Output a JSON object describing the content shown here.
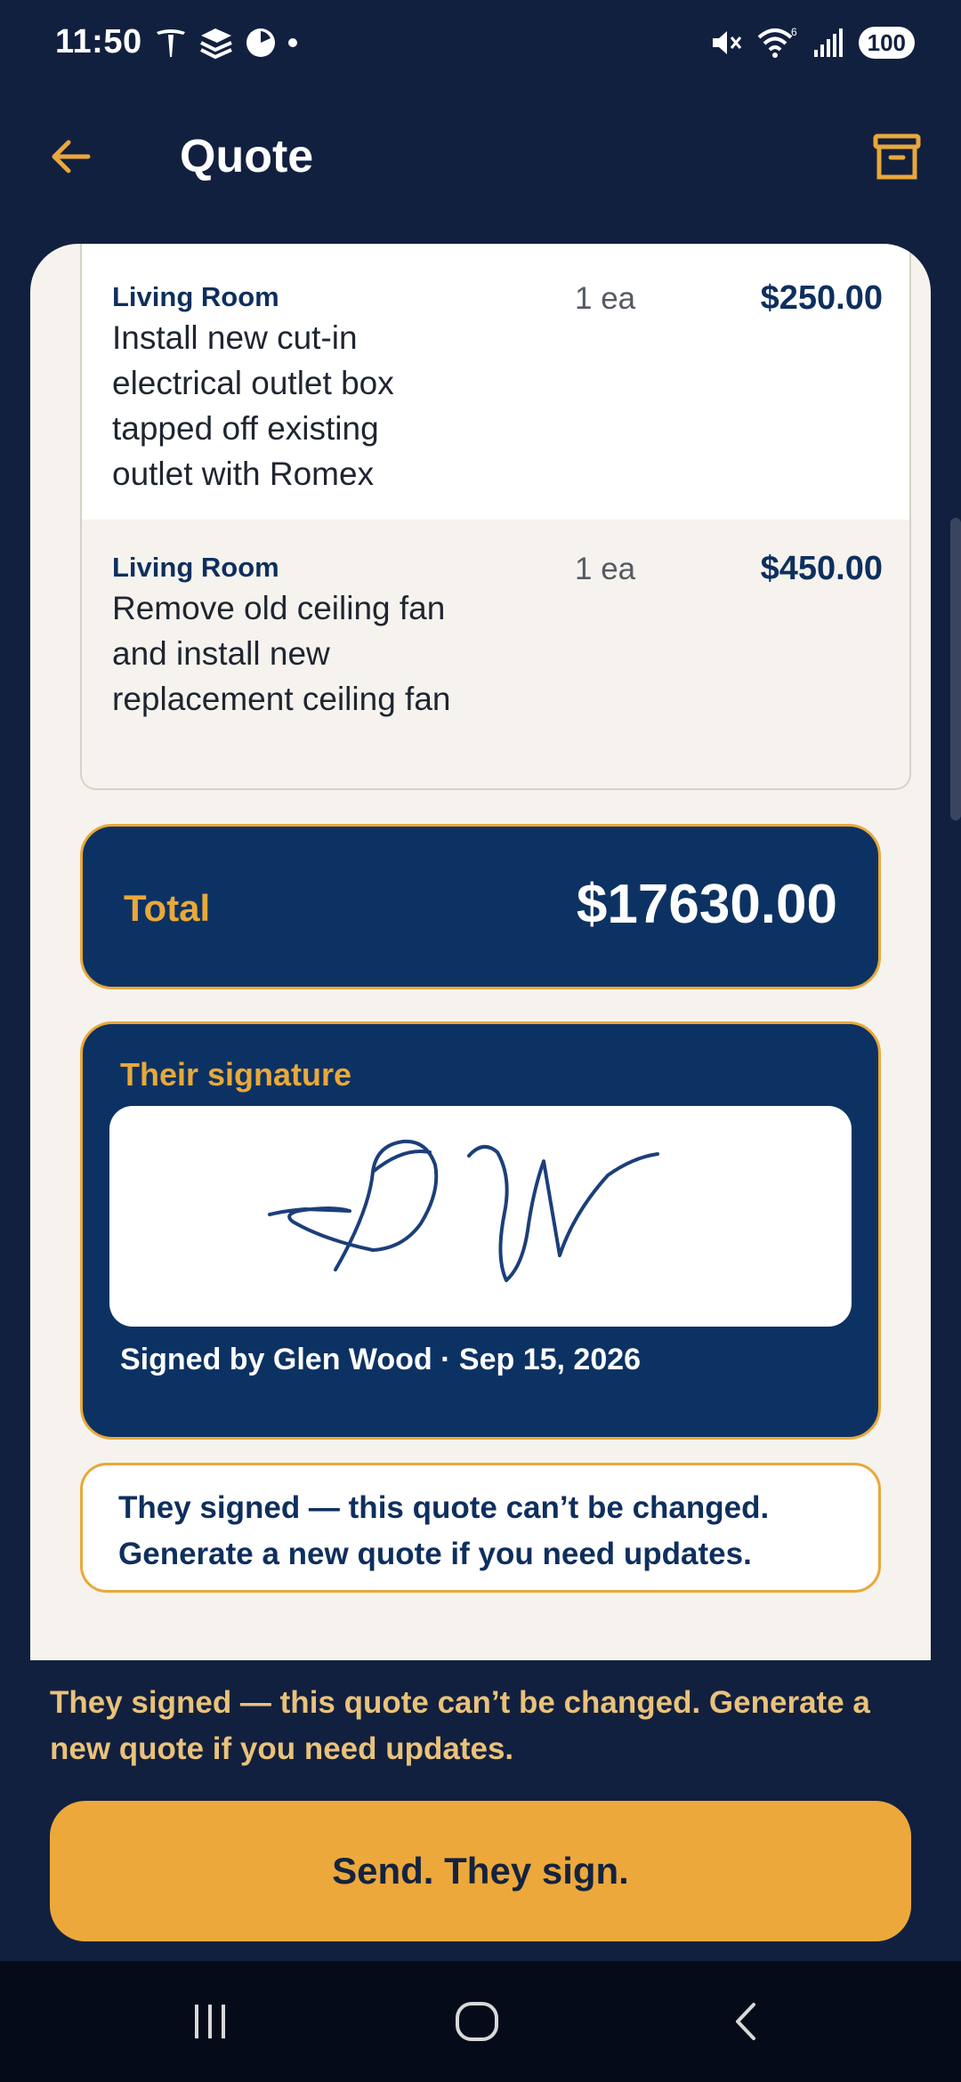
{
  "status_bar": {
    "time": "11:50",
    "battery": "100"
  },
  "app_bar": {
    "title": "Quote"
  },
  "line_items": [
    {
      "room": "Living Room",
      "description": "Install new cut-in electrical outlet box tapped off existing outlet with Romex",
      "quantity": "1 ea",
      "price": "$250.00"
    },
    {
      "room": "Living Room",
      "description": "Remove old ceiling fan and install new replacement ceiling fan",
      "quantity": "1 ea",
      "price": "$450.00"
    }
  ],
  "total": {
    "label": "Total",
    "value": "$17630.00"
  },
  "signature": {
    "title": "Their signature",
    "signed_by": "Signed by Glen Wood · Sep 15, 2026"
  },
  "locked_note": "They signed — this quote can’t be changed. Generate a new quote if you need updates.",
  "footer_note": "They signed — this quote can’t be changed. Generate a new quote if you need updates.",
  "send_button": "Send. They sign.",
  "colors": {
    "background": "#12203f",
    "accent": "#e9a83a",
    "card_navy": "#0c3263",
    "sheet": "#f6f3ee"
  }
}
